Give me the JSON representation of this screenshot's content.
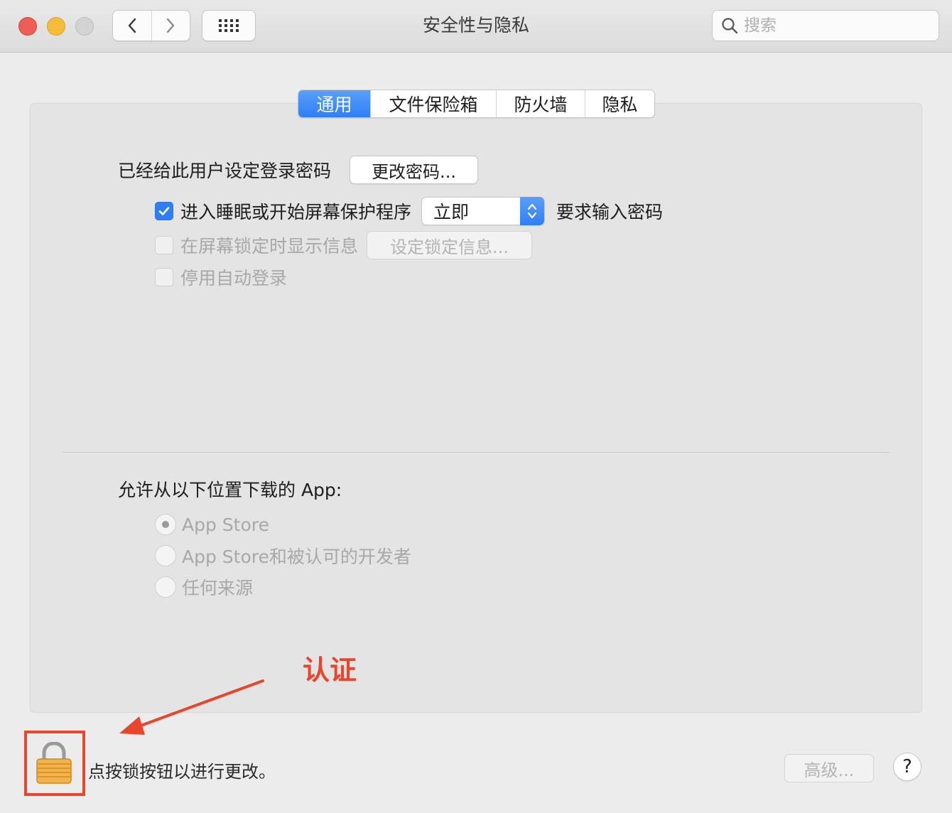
{
  "window": {
    "title": "安全性与隐私",
    "search_placeholder": "搜索"
  },
  "tabs": [
    {
      "label": "通用",
      "active": true
    },
    {
      "label": "文件保险箱",
      "active": false
    },
    {
      "label": "防火墙",
      "active": false
    },
    {
      "label": "隐私",
      "active": false
    }
  ],
  "general": {
    "password_label": "已经给此用户设定登录密码",
    "change_password_button": "更改密码...",
    "require_password": {
      "checked": true,
      "label_before": "进入睡眠或开始屏幕保护程序",
      "select_value": "立即",
      "label_after": "要求输入密码"
    },
    "show_message": {
      "checked": false,
      "label": "在屏幕锁定时显示信息",
      "button": "设定锁定信息..."
    },
    "disable_autologin": {
      "checked": false,
      "label": "停用自动登录"
    }
  },
  "downloads": {
    "heading": "允许从以下位置下载的 App:",
    "options": [
      {
        "label": "App Store",
        "selected": true
      },
      {
        "label": "App Store和被认可的开发者",
        "selected": false
      },
      {
        "label": "任何来源",
        "selected": false
      }
    ]
  },
  "annotation": {
    "text": "认证",
    "color": "#e8462c"
  },
  "footer": {
    "lock_text": "点按锁按钮以进行更改。",
    "advanced_button": "高级...",
    "help_button": "?"
  },
  "colors": {
    "accent": "#2f7ef6",
    "annotation": "#e8462c"
  }
}
